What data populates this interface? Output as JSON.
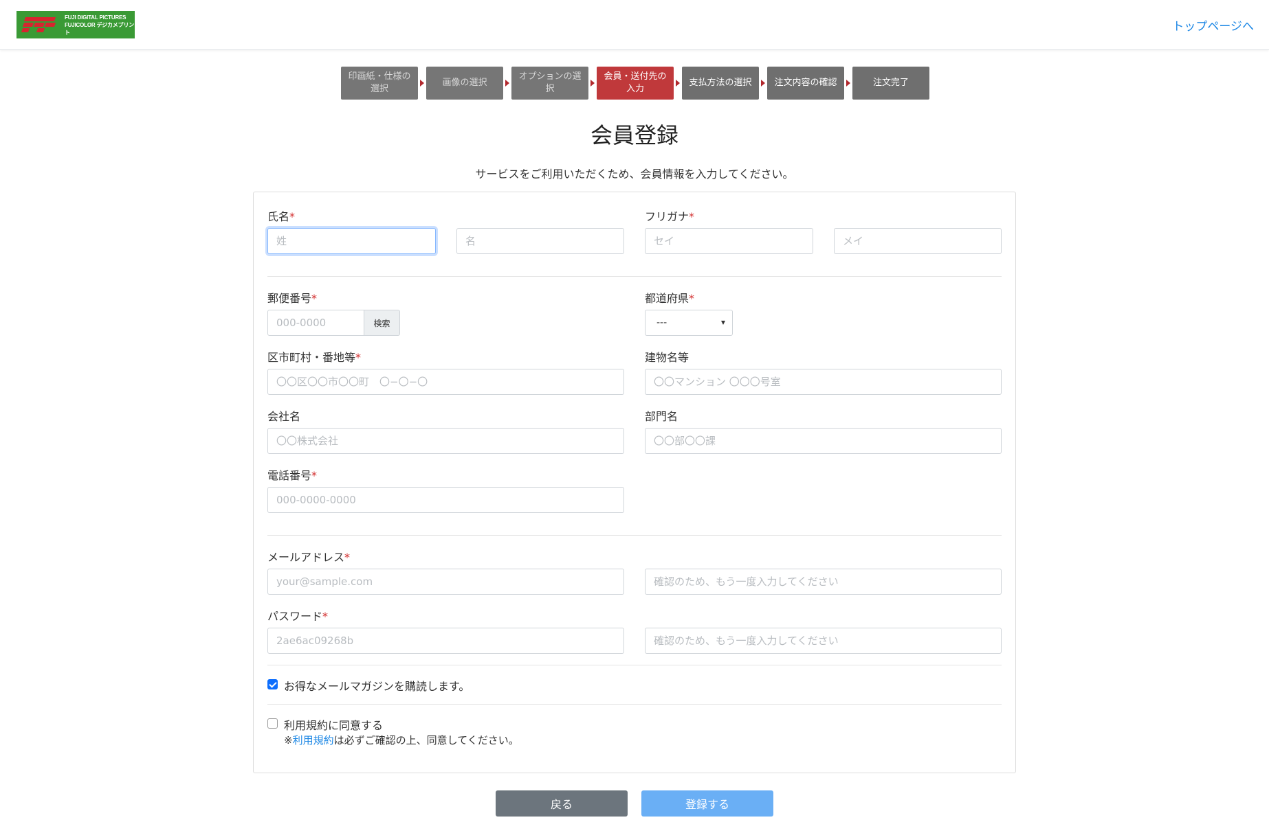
{
  "header": {
    "logo_line1": "FUJI DIGITAL PICTURES",
    "logo_line2": "FUJICOLOR デジカメプリント",
    "top_link": "トップページへ"
  },
  "steps": [
    {
      "label": "印画紙・仕様の選択",
      "state": "done"
    },
    {
      "label": "画像の選択",
      "state": "done"
    },
    {
      "label": "オプションの選択",
      "state": "done"
    },
    {
      "label": "会員・送付先の入力",
      "state": "active"
    },
    {
      "label": "支払方法の選択",
      "state": "todo"
    },
    {
      "label": "注文内容の確認",
      "state": "todo"
    },
    {
      "label": "注文完了",
      "state": "todo"
    }
  ],
  "page": {
    "title": "会員登録",
    "lead": "サービスをご利用いただくため、会員情報を入力してください。"
  },
  "form": {
    "name": {
      "label": "氏名",
      "last_placeholder": "姓",
      "first_placeholder": "名"
    },
    "kana": {
      "label": "フリガナ",
      "last_placeholder": "セイ",
      "first_placeholder": "メイ"
    },
    "postal": {
      "label": "郵便番号",
      "placeholder": "000-0000",
      "search_label": "検索"
    },
    "prefecture": {
      "label": "都道府県",
      "value": "---"
    },
    "address": {
      "label": "区市町村・番地等",
      "placeholder": "〇〇区〇〇市〇〇町　〇−〇−〇"
    },
    "building": {
      "label": "建物名等",
      "placeholder": "〇〇マンション 〇〇〇号室"
    },
    "company": {
      "label": "会社名",
      "placeholder": "〇〇株式会社"
    },
    "department": {
      "label": "部門名",
      "placeholder": "〇〇部〇〇課"
    },
    "phone": {
      "label": "電話番号",
      "placeholder": "000-0000-0000"
    },
    "email": {
      "label": "メールアドレス",
      "placeholder": "your@sample.com",
      "confirm_placeholder": "確認のため、もう一度入力してください"
    },
    "password": {
      "label": "パスワード",
      "placeholder": "2ae6ac09268b",
      "confirm_placeholder": "確認のため、もう一度入力してください"
    },
    "required_mark": "*",
    "newsletter": {
      "label": "お得なメールマガジンを購読します。",
      "checked": true
    },
    "terms": {
      "label": "利用規約に同意する",
      "note_prefix": "※",
      "note_link": "利用規約",
      "note_suffix": "は必ずご確認の上、同意してください。",
      "checked": false
    }
  },
  "buttons": {
    "back": "戻る",
    "submit": "登録する"
  },
  "colors": {
    "logo_bg": "#3a9a35",
    "step_active": "#c0393b",
    "step_inactive": "#6c6c6c",
    "link": "#1e88e5",
    "submit": "#6aaff5",
    "back": "#6c757d"
  }
}
